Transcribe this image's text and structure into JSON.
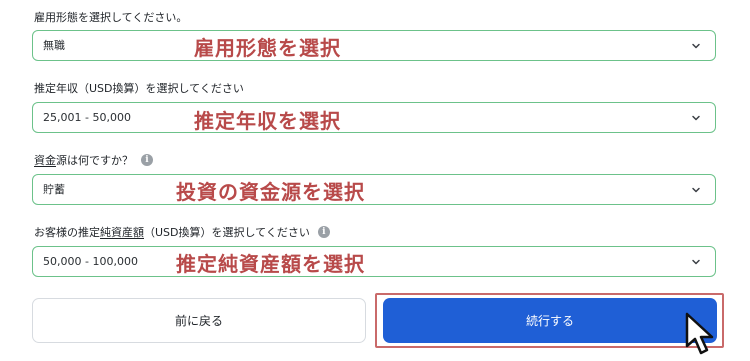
{
  "fields": [
    {
      "label_plain": "雇用形態を選択してください。",
      "value": "無職",
      "annotation": "雇用形態を選択"
    },
    {
      "label_plain": "推定年収（USD換算）を選択してください",
      "value": "25,001 - 50,000",
      "annotation": "推定年収を選択"
    },
    {
      "label_underlined": "資金",
      "label_rest": "源は何ですか？",
      "value": "貯蓄",
      "annotation": "投資の資金源を選択",
      "info_icon": "info-icon"
    },
    {
      "label_prefix": "お客様の推定",
      "label_underlined": "純資産額",
      "label_rest": "（USD換算）を選択してください",
      "value": "50,000 - 100,000",
      "annotation": "推定純資産額を選択",
      "info_icon": "info-icon"
    }
  ],
  "info_glyph": "i",
  "buttons": {
    "back_label": "前に戻る",
    "continue_label": "続行する"
  },
  "colors": {
    "select_border": "#6cc28a",
    "annotation_text": "#b84a4a",
    "highlight_box": "#c96a6a",
    "primary_button": "#1f5fd6",
    "secondary_border": "#d7dbe0"
  },
  "cursor_icon": "mouse-pointer-icon",
  "chevron_icon": "chevron-down-icon"
}
